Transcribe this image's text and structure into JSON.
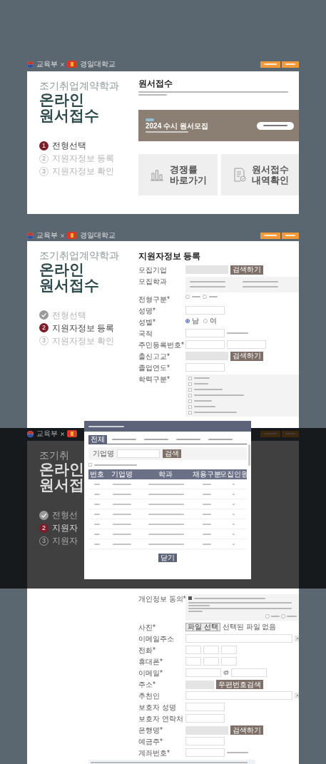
{
  "screens": [
    {
      "kind": "select",
      "header": {
        "ministry": "교육부",
        "university": "경일대학교"
      },
      "intro": {
        "subtitle": "조기취업계약학과",
        "title_lines": [
          "온라인",
          "원서접수"
        ]
      },
      "steps": [
        {
          "number": "1",
          "label": "전형선택",
          "current": true,
          "done": false
        },
        {
          "number": "2",
          "label": "지원자정보 등록",
          "current": false,
          "done": false
        },
        {
          "number": "3",
          "label": "지원자정보 확인",
          "current": false,
          "done": false
        }
      ],
      "heading": "원서접수",
      "banner": {
        "title": "2024 수시 원서모집"
      },
      "tiles": [
        {
          "kind": "chart",
          "lines": [
            "경쟁률",
            "바로가기"
          ]
        },
        {
          "kind": "document",
          "lines": [
            "원서접수",
            "내역확인"
          ]
        }
      ]
    },
    {
      "kind": "form",
      "header": {
        "ministry": "교육부",
        "university": "경일대학교"
      },
      "intro": {
        "subtitle": "조기취업계약학과",
        "title_lines": [
          "온라인",
          "원서접수"
        ]
      },
      "steps": [
        {
          "label": "전형선택",
          "current": false,
          "done": true
        },
        {
          "number": "2",
          "label": "지원자정보 등록",
          "current": true,
          "done": false
        },
        {
          "number": "3",
          "label": "지원자정보 확인",
          "current": false,
          "done": false
        }
      ],
      "heading": "지원자정보 등록",
      "fields": [
        {
          "kind": "search",
          "label": "모집기업",
          "button": "검색하기"
        },
        {
          "kind": "options",
          "label": "모집학과"
        },
        {
          "kind": "radio",
          "label": "전형구분*",
          "options": [
            {
              "selected": false
            },
            {
              "selected": false
            }
          ]
        },
        {
          "kind": "input",
          "label": "성명*"
        },
        {
          "kind": "radio",
          "label": "성별*",
          "options": [
            {
              "label": "남",
              "selected": true
            },
            {
              "label": "여",
              "selected": false
            }
          ]
        },
        {
          "kind": "input_note",
          "label": "국적"
        },
        {
          "kind": "double",
          "label": "주민등록번호*"
        },
        {
          "kind": "search",
          "label": "출신고교*",
          "button": "검색하기"
        },
        {
          "kind": "input",
          "label": "졸업연도*"
        },
        {
          "kind": "checklist",
          "label": "학력구분*",
          "items": [
            {
              "checked": false
            },
            {
              "checked": false
            },
            {
              "checked": false
            },
            {
              "checked": false
            },
            {
              "checked": false
            },
            {
              "checked": false
            },
            {
              "checked": false
            }
          ]
        }
      ]
    },
    {
      "kind": "form",
      "header": {
        "ministry": "교육부"
      },
      "intro": {
        "subtitle": "조기취",
        "title_lines": [
          "온라인",
          "원서접"
        ]
      },
      "steps": [
        {
          "label": "전형선",
          "current": false,
          "done": true
        },
        {
          "number": "2",
          "label": "지원자",
          "current": true,
          "done": false
        },
        {
          "number": "3",
          "label": "지원자",
          "current": false,
          "done": false
        }
      ],
      "fields": [
        {
          "kind": "agreement",
          "label": "개인정보 동의*",
          "checked": true
        },
        {
          "kind": "file",
          "label": "사진*",
          "button": "파일 선택",
          "note": "선택된 파일 없음"
        },
        {
          "kind": "input_wide",
          "label": "이메일주소"
        },
        {
          "kind": "triple",
          "label": "전화*"
        },
        {
          "kind": "triple",
          "label": "휴대폰*"
        },
        {
          "kind": "email",
          "label": "이메일*",
          "at": "@"
        },
        {
          "kind": "address",
          "label": "주소*",
          "button": "우편번호검색"
        },
        {
          "kind": "input_wide",
          "label": "추천인"
        },
        {
          "kind": "input",
          "label": "보호자 성명"
        },
        {
          "kind": "input",
          "label": "보호자 연락처"
        },
        {
          "kind": "search",
          "label": "은행명*",
          "button": "검색하기"
        },
        {
          "kind": "input",
          "label": "예금주*"
        },
        {
          "kind": "input_note",
          "label": "계좌번호*"
        },
        {
          "kind": "notice"
        }
      ],
      "modal": {
        "tabs": [
          {
            "label": "전체",
            "selected": true
          },
          {
            "selected": false
          },
          {
            "selected": false
          },
          {
            "selected": false
          },
          {
            "selected": false
          }
        ],
        "search": {
          "label": "기업명",
          "button": "검색"
        },
        "columns": [
          "번호",
          "기업명",
          "학과",
          "채용구분",
          "모집인원"
        ],
        "rows": [
          {
            "kind": "row"
          },
          {
            "kind": "row"
          },
          {
            "kind": "row"
          },
          {
            "kind": "row"
          },
          {
            "kind": "row"
          },
          {
            "kind": "row"
          },
          {
            "kind": "row"
          }
        ],
        "close": "닫기"
      }
    }
  ]
}
